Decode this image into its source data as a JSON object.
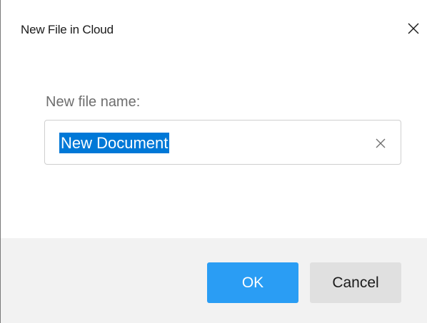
{
  "dialog": {
    "title": "New File in Cloud",
    "close_icon": "close-icon"
  },
  "form": {
    "label": "New file name:",
    "value": "New Document",
    "clear_icon": "clear-icon"
  },
  "footer": {
    "ok_label": "OK",
    "cancel_label": "Cancel"
  },
  "colors": {
    "primary": "#2a9df4",
    "selection": "#0078d7",
    "footer_bg": "#f2f2f2",
    "secondary_button": "#e0e0e0"
  }
}
